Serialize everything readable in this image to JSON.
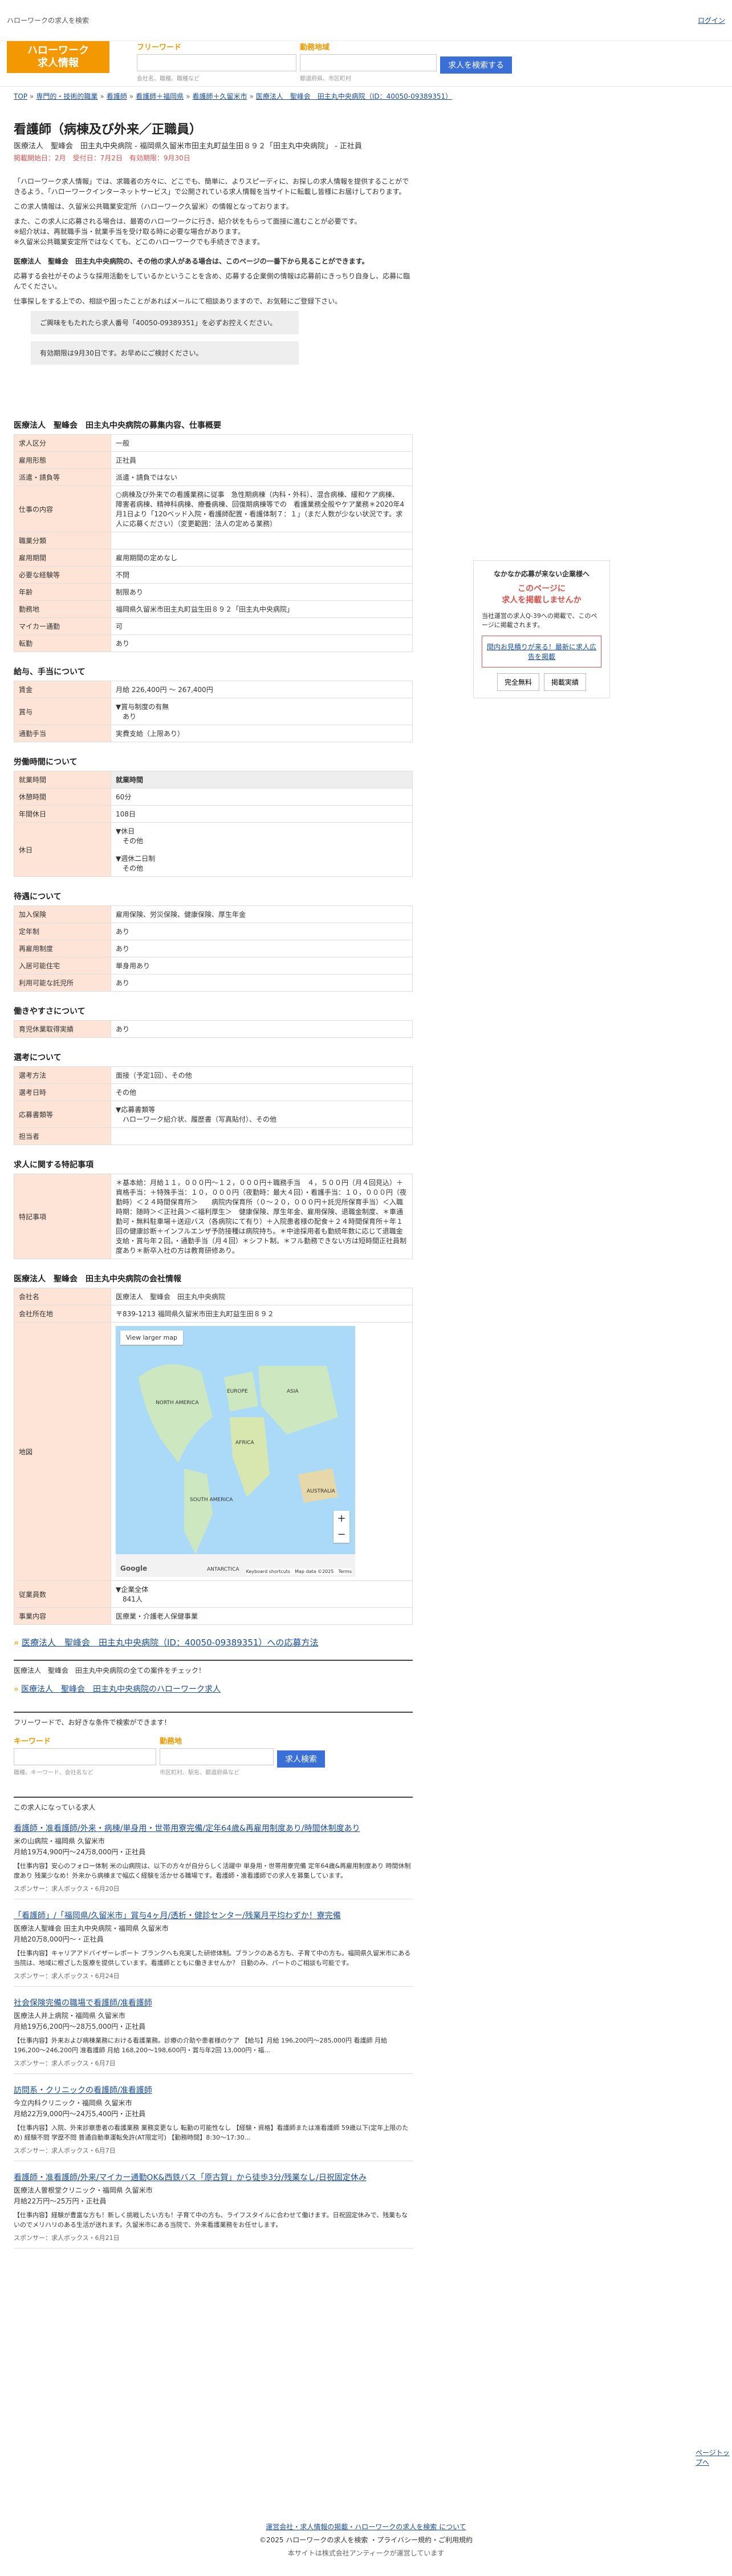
{
  "topbar": {
    "site_desc": "ハローワークの求人を検索",
    "login": "ログイン"
  },
  "logo": {
    "line1": "ハローワーク",
    "line2": "求人情報"
  },
  "search": {
    "keyword_label": "フリーワード",
    "keyword_placeholder": "",
    "keyword_hint": "会社名、職種、職種など",
    "location_label": "勤務地域",
    "location_hint": "都道府県、市区町村",
    "button": "求人を検索する"
  },
  "breadcrumb": [
    "TOP",
    "専門的・技術的職業",
    "看護師",
    "看護師＋福岡県",
    "看護師＋久留米市",
    "医療法人　聖峰会　田主丸中央病院（ID：40050-09389351）"
  ],
  "job": {
    "title": "看護師（病棟及び外来／正職員）",
    "sub": "医療法人　聖峰会　田主丸中央病院 - 福岡県久留米市田主丸町益生田８９２「田主丸中央病院」 - 正社員",
    "dates": "掲載開始日：2月　受付日：7月2日　有効期限：9月30日"
  },
  "notice": [
    "「ハローワーク求人情報」では、求職者の方々に、どこでも、簡単に、よりスピーディに、お探しの求人情報を提供することができるよう、「ハローワークインターネットサービス」で公開されている求人情報を当サイトに転載し皆様にお届けしております。",
    "この求人情報は、久留米公共職業安定所（ハローワーク久留米）の情報となっております。",
    "また、この求人に応募される場合は、最寄のハローワークに行き、紹介状をもらって面接に進むことが必要です。",
    "※紹介状は、再就職手当・就業手当を受け取る時に必要な場合があります。",
    "※久留米公共職業安定所ではなくても、どこのハローワークでも手続きできます。",
    "医療法人　聖峰会　田主丸中央病院の、その他の求人がある場合は、このページの一番下から見ることができます。",
    "応募する会社がそのような採用活動をしているかということを含め、応募する企業側の情報は応募前にきっちり自身し、応募に臨んでください。",
    "仕事探しをする上での、相談や困ったことがあればメールにて相談ありますので、お気軽にご登録下さい。"
  ],
  "notice_boxes": [
    "ご興味をもたれたら求人番号「40050-09389351」を必ずお控えください。",
    "有効期限は9月30日です。お早めにご検討ください。"
  ],
  "sections": {
    "basic_title": "医療法人　聖峰会　田主丸中央病院の募集内容、仕事概要",
    "basic": [
      [
        "求人区分",
        "一般"
      ],
      [
        "雇用形態",
        "正社員"
      ],
      [
        "派遣・請負等",
        "派遣・請負ではない"
      ],
      [
        "仕事の内容",
        "○病棟及び外来での看護業務に従事　急性期病棟（内科・外科）、混合病棟、緩和ケア病棟、　障害者病棟、精神科病棟、療養病棟、回復期病棟等での　看護業務全般やケア業務＊2020年4月1日より「120ベッド入院・看護師配置・看護体制７：１」（まだ人数が少ない状況です。求人に応募ください）（変更範囲：法人の定める業務）"
      ],
      [
        "職業分類",
        ""
      ],
      [
        "雇用期間",
        "雇用期間の定めなし"
      ],
      [
        "必要な経験等",
        "不問"
      ],
      [
        "年齢",
        "制限あり"
      ],
      [
        "勤務地",
        "福岡県久留米市田主丸町益生田８９２「田主丸中央病院」"
      ],
      [
        "マイカー通勤",
        "可"
      ],
      [
        "転勤",
        "あり"
      ]
    ],
    "pay_title": "給与、手当について",
    "pay": [
      [
        "賃金",
        "月給 226,400円 〜 267,400円"
      ],
      [
        "賞与",
        "▼賞与制度の有無\n　あり"
      ],
      [
        "通勤手当",
        "実費支給（上限あり）"
      ]
    ],
    "hours_title": "労働時間について",
    "hours": [
      [
        "就業時間",
        "就業時間"
      ],
      [
        "休憩時間",
        "60分"
      ],
      [
        "年間休日",
        "108日"
      ],
      [
        "休日",
        "▼休日\n　その他\n\n▼週休二日制\n　その他"
      ]
    ],
    "benefit_title": "待遇について",
    "benefit": [
      [
        "加入保険",
        "雇用保険、労災保険、健康保険、厚生年金"
      ],
      [
        "定年制",
        "あり"
      ],
      [
        "再雇用制度",
        "あり"
      ],
      [
        "入居可能住宅",
        "単身用あり"
      ],
      [
        "利用可能な託児所",
        "あり"
      ]
    ],
    "easy_title": "働きやすさについて",
    "easy": [
      [
        "育児休業取得実績",
        "あり"
      ]
    ],
    "select_title": "選考について",
    "select": [
      [
        "選考方法",
        "面接（予定1回）、その他"
      ],
      [
        "選考日時",
        "その他"
      ],
      [
        "応募書類等",
        "▼応募書類等\n　ハローワーク紹介状、履歴書（写真貼付）、その他"
      ],
      [
        "担当者",
        ""
      ]
    ],
    "special_title": "求人に関する特記事項",
    "special": [
      [
        "特記事項",
        "＊基本給：月給１１，０００円〜１２，０００円＋職務手当　４，５００円（月４回見込）＋ 資格手当：＋特殊手当：１０，０００円（夜勤時：最大４回）・看護手当：１０，０００円（夜勤時）＜２４時間保育所＞　　病院内保育所（０〜２０，０００円＋託児所保育手当）＜入職時期：随時＞＜正社員＞＜福利厚生＞　健康保険、厚生年金、雇用保険、退職金制度、＊車通勤可・無料駐車場＋送迎バス（各病院にて有り）＋入院患者様の配食＋２４時間保育所＋年１回の健康診断＋インフルエンザ予防接種は病院持ち。＊中途採用者も勤続年数に応じて退職金支給・賞与年２回。・通勤手当（月４回）＊シフト制。＊フル勤務できない方は短時間正社員制度あり＊新卒入社の方は教育研修あり。"
      ]
    ],
    "company_title": "医療法人　聖峰会　田主丸中央病院の会社情報",
    "company": [
      [
        "会社名",
        "医療法人　聖峰会　田主丸中央病院"
      ],
      [
        "会社所在地",
        "〒839-1213 福岡県久留米市田主丸町益生田８９２"
      ],
      [
        "地図",
        ""
      ],
      [
        "従業員数",
        "▼企業全体\n　841人"
      ],
      [
        "事業内容",
        "医療業・介護老人保健事業"
      ]
    ]
  },
  "map": {
    "view_larger": "View larger map",
    "footer": "Keyboard shortcuts　Map data ©2025　Terms",
    "google": "Google",
    "labels": [
      "NORTH AMERICA",
      "EUROPE",
      "ASIA",
      "AFRICA",
      "SOUTH AMERICA",
      "AUSTRALIA",
      "ANTARCTICA"
    ]
  },
  "company_link": "医療法人　聖峰会　田主丸中央病院（ID：40050-09389351）への応募方法",
  "share": {
    "heading": "医療法人　聖峰会　田主丸中央病院の全ての案件をチェック！",
    "link": "医療法人　聖峰会　田主丸中央病院のハローワーク求人"
  },
  "search2": {
    "heading": "フリーワードで、お好きな条件で検索ができます！",
    "keyword_label": "キーワード",
    "location_label": "勤務地",
    "keyword_hint": "職種、キーワード、会社名など",
    "location_hint": "市区町村、駅名、都道府県など",
    "button": "求人検索"
  },
  "related_title": "この求人になっている求人",
  "related": [
    {
      "title": "看護師・准看護師/外来・病棟/単身用・世帯用寮完備/定年64歳&再雇用制度あり/時間休制度あり",
      "company": "米の山病院・福岡県 久留米市",
      "salary": "月給19万4,900円〜24万8,000円・正社員",
      "desc": "【仕事内容】安心のフォロー体制 米の山病院は、以下の方々が自分らしく活躍中 単身用・世帯用寮完備 定年64歳&再雇用制度あり 時間休制度あり 残業少なめ！外来から病棟まで幅広く経験を活かせる職場です。看護師・准看護師での求人を募集しています。",
      "sponsor": "スポンサー：求人ボックス・6月20日"
    },
    {
      "title": "「看護師」/「福岡県/久留米市」賞与4ヶ月/透析・健診センター/残業月平均わずか！寮完備",
      "company": "医療法人聖峰会 田主丸中央病院・福岡県 久留米市",
      "salary": "月給20万8,000円〜・正社員",
      "desc": "【仕事内容】キャリアアドバイザーレポート ブランクへも充実した研修体制。ブランクのある方も、子育て中の方も。福岡県久留米市にある当院は、地域に根ざした医療を提供しています。看護師とともに働きませんか？ 日勤のみ、パートのご相談も可能です。",
      "sponsor": "スポンサー：求人ボックス・6月24日"
    },
    {
      "title": "社会保険完備の職場で看護師/准看護師",
      "company": "医療法人井上病院・福岡県 久留米市",
      "salary": "月給19万6,200円〜28万5,000円・正社員",
      "desc": "【仕事内容】外来および病棟業務における看護業務。診療の介助や患者様のケア 【給与】月給 196,200円〜285,000円 看護師 月給 196,200〜246,200円 准看護師 月給 168,200〜198,600円・賞与年2回 13,000円・福...",
      "sponsor": "スポンサー：求人ボックス・6月7日"
    },
    {
      "title": "訪問系・クリニックの看護師/准看護師",
      "company": "今立内科クリニック・福岡県 久留米市",
      "salary": "月給22万9,000円〜24万5,400円・正社員",
      "desc": "【仕事内容】入院、外来診察患者の看護業務 業務変更なし 転勤の可能性なし 【経験・資格】看護師または准看護師 59歳以下(定年上限のため) 経験不問 学歴不問 普通自動車運転免許(AT限定可) 【勤務時間】8:30〜17:30...",
      "sponsor": "スポンサー：求人ボックス・6月7日"
    },
    {
      "title": "看護師・准看護師/外来/マイカー通勤OK&西鉄バス「原古賀」から徒歩3分/残業なし/日祝固定休み",
      "company": "医療法人曽根堂クリニック・福岡県 久留米市",
      "salary": "月給22万円〜25万円・正社員",
      "desc": "【仕事内容】経験が豊富な方も！新しく挑戦したい方も！子育て中の方も、ライフスタイルに合わせて働けます。日祝固定休みで、残業もないのでメリハリのある生活が送れます。久留米市にある当院で、外来看護業務をお任せします。",
      "sponsor": "スポンサー：求人ボックス・6月21日"
    }
  ],
  "pagetop": "ページトップへ",
  "footer": {
    "links": "運営会社・求人情報の掲載・ハローワークの求人を検索 について",
    "copyright": "©2025 ハローワークの求人を検索 ・プライバシー規約・ご利用規約",
    "operator": "本サイトは株式会社アンティークが運営しています"
  },
  "side": {
    "title": "なかなか応募が来ない企業様へ",
    "red": "このページに\n求人を掲載しませんか",
    "text": "当社運営の求人Q-39への掲載で、このページに掲載されます。",
    "link": "間内お見積りが来る！最新に求人広告を掲載",
    "btn1": "完全無料",
    "btn2": "掲載実績"
  }
}
